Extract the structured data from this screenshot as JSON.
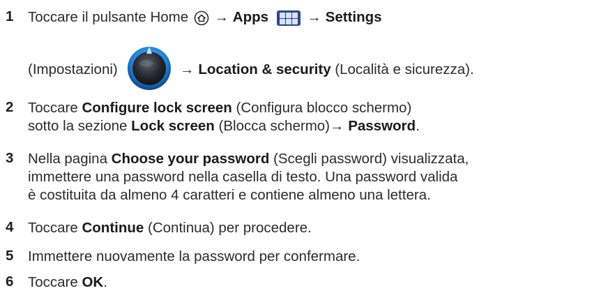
{
  "steps": [
    {
      "number": "1",
      "line1_a": "Toccare il pulsante Home",
      "line1_arrow1": " → ",
      "line1_apps": "Apps",
      "line1_arrow2": " → ",
      "line1_settings": "Settings",
      "line2_a": "(Impostazioni)",
      "line2_arrow": " → ",
      "line2_location": "Location & security",
      "line2_b": " (Località e sicurezza)."
    },
    {
      "number": "2",
      "line1_a": "Toccare ",
      "line1_bold": "Configure lock screen",
      "line1_b": " (Configura blocco schermo)",
      "line2_a": "sotto la sezione ",
      "line2_bold1": "Lock screen",
      "line2_b": " (Blocca schermo)→ ",
      "line2_bold2": "Password",
      "line2_c": "."
    },
    {
      "number": "3",
      "line1_a": "Nella pagina ",
      "line1_bold": "Choose your password",
      "line1_b": " (Scegli password) visualizzata,",
      "line2": "immettere una password nella casella di testo. Una password valida",
      "line3": "è costituita da almeno 4 caratteri e contiene almeno una lettera."
    },
    {
      "number": "4",
      "line1_a": "Toccare ",
      "line1_bold": "Continue",
      "line1_b": " (Continua) per procedere."
    },
    {
      "number": "5",
      "line1": "Immettere nuovamente la password per confermare."
    },
    {
      "number": "6",
      "line1_a": "Toccare ",
      "line1_bold": "OK",
      "line1_b": "."
    }
  ],
  "icons": {
    "home": "home-icon",
    "apps": "apps-grid-icon",
    "settings": "settings-icon"
  },
  "colors": {
    "apps_icon_bg": "#2b4a8a",
    "settings_ring": "#1e90ff"
  }
}
